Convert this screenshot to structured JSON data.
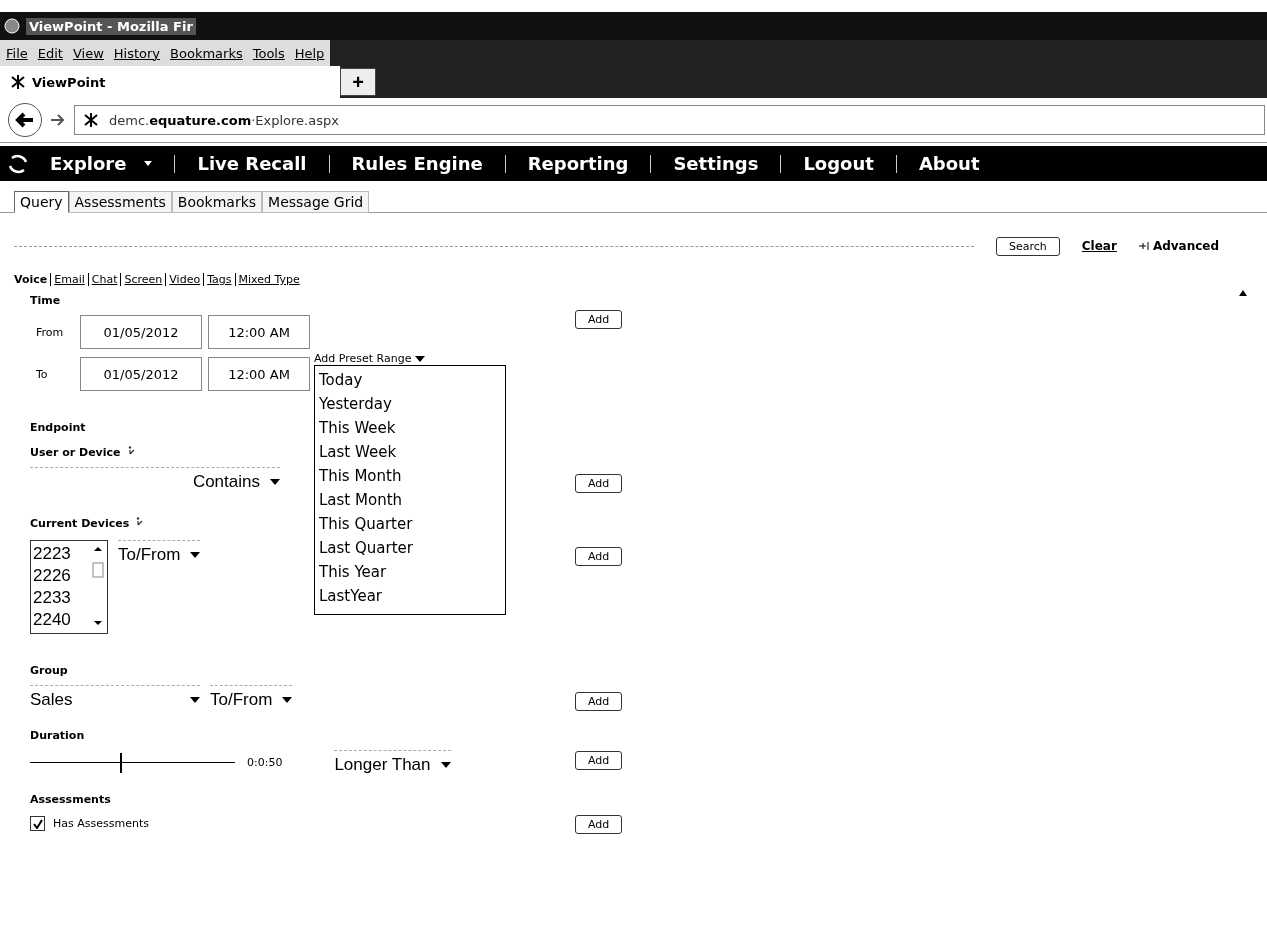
{
  "window": {
    "title": "ViewPoint - Mozilla Fir"
  },
  "menu_bar": [
    "File",
    "Edit",
    "View",
    "History",
    "Bookmarks",
    "Tools",
    "Help"
  ],
  "browser_tab": {
    "title": "ViewPoint",
    "new_tab": "+"
  },
  "address": {
    "url": "demc.**equature.com**·Explore.aspx"
  },
  "nav": [
    {
      "label": "Explore",
      "has_caret": true
    },
    {
      "label": "Live Recall",
      "has_caret": false
    },
    {
      "label": "Rules Engine",
      "has_caret": false
    },
    {
      "label": "Reporting",
      "has_caret": false
    },
    {
      "label": "Settings",
      "has_caret": false
    },
    {
      "label": "Logout",
      "has_caret": false
    },
    {
      "label": "About",
      "has_caret": false
    }
  ],
  "sub_tabs": [
    {
      "label": "Query",
      "selected": true
    },
    {
      "label": "Assessments",
      "selected": false
    },
    {
      "label": "Bookmarks",
      "selected": false
    },
    {
      "label": "Message Grid",
      "selected": false
    }
  ],
  "search_bar": {
    "search": "Search",
    "clear": "Clear",
    "advanced": "Advanced"
  },
  "media_types": [
    {
      "label": "Voice",
      "selected": true
    },
    {
      "label": "Email",
      "selected": false
    },
    {
      "label": "Chat",
      "selected": false
    },
    {
      "label": "Screen",
      "selected": false
    },
    {
      "label": "Video",
      "selected": false
    },
    {
      "label": "Tags",
      "selected": false
    },
    {
      "label": "Mixed Type",
      "selected": false
    }
  ],
  "time": {
    "label": "Time",
    "add": "Add",
    "rows": [
      {
        "label": "From",
        "date": "01/05/2012",
        "time": "12:00 AM"
      },
      {
        "label": "To",
        "date": "01/05/2012",
        "time": "12:00 AM"
      }
    ]
  },
  "preset_range": {
    "label": "Add Preset Range",
    "expanded": true,
    "options": [
      "Today",
      "Yesterday",
      "This Week",
      "Last Week",
      "This Month",
      "Last Month",
      "This Quarter",
      "Last Quarter",
      "This Year",
      "LastYear"
    ]
  },
  "endpoint": {
    "label": "Endpoint"
  },
  "user_or_device": {
    "label": "User or Device",
    "operator": "Contains",
    "add": "Add"
  },
  "current_devices": {
    "label": "Current Devices",
    "options": [
      "2223",
      "2226",
      "2233",
      "2240"
    ],
    "direction": "To/From",
    "add": "Add"
  },
  "group": {
    "label": "Group",
    "value": "Sales",
    "direction": "To/From",
    "add": "Add"
  },
  "duration": {
    "label": "Duration",
    "level": 0.44,
    "reading": "0:0:50",
    "comparison": "Longer Than",
    "add": "Add"
  },
  "assessments": {
    "label": "Assessments",
    "checkbox": {
      "label": "Has Assessments",
      "checked": true
    },
    "add": "Add"
  }
}
